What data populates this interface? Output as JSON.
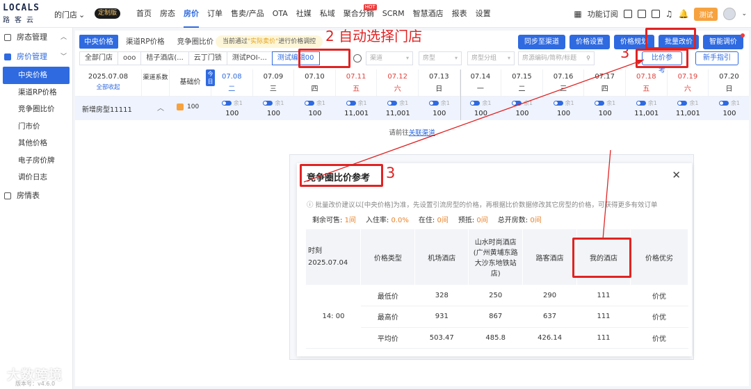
{
  "logo": {
    "main": "LOCALS",
    "sub": "路客云"
  },
  "store": {
    "label": "的门店",
    "badge": "定制版"
  },
  "nav": [
    {
      "label": "首页"
    },
    {
      "label": "房态"
    },
    {
      "label": "房价",
      "active": true
    },
    {
      "label": "订单"
    },
    {
      "label": "售卖/产品"
    },
    {
      "label": "OTA"
    },
    {
      "label": "社媒"
    },
    {
      "label": "私域"
    },
    {
      "label": "聚合分销",
      "hot": "HOT"
    },
    {
      "label": "SCRM"
    },
    {
      "label": "智慧酒店"
    },
    {
      "label": "报表"
    },
    {
      "label": "设置"
    }
  ],
  "topright": {
    "subscription": "功能订阅",
    "test": "测试"
  },
  "sidebar": {
    "group1": "房态管理",
    "group2": "房价管理",
    "items": [
      "中央价格",
      "渠道RP价格",
      "竞争圈比价",
      "门市价",
      "其他价格",
      "电子房价牌",
      "调价日志"
    ],
    "group3": "房情表",
    "version": "版本号：v4.6.0"
  },
  "watermark": "大数跨境",
  "tabs": [
    "中央价格",
    "渠道RP价格",
    "竞争圈比价"
  ],
  "notice": {
    "pre": "当前通过",
    "hl": "\"实际卖价\"",
    "post": "进行价格调控"
  },
  "annotations": {
    "a1": "2 自动选择门店",
    "a2": "3",
    "a3": "3"
  },
  "top_buttons": [
    "同步至渠道",
    "价格设置",
    "价格规划",
    "批量改价",
    "智能调价"
  ],
  "filters": [
    "全部门店",
    "ooo",
    "桔子酒店(...",
    "云丁门锁",
    "测试POI-...",
    "测试编辑00"
  ],
  "selects": {
    "channel": "渠道",
    "room": "房型",
    "group": "房型分组",
    "search": "房源编码/简称/标题"
  },
  "btn_compare": "比价参考",
  "btn_guide": "新手指引",
  "grid": {
    "date_sel": "2025.07.08",
    "collapse": "全部收起",
    "channel_coef": "渠道系数",
    "base_price_label": "基础价",
    "today": "今日",
    "columns": [
      {
        "d": "07.08",
        "w": "二",
        "t": "sel"
      },
      {
        "d": "07.09",
        "w": "三",
        "t": ""
      },
      {
        "d": "07.10",
        "w": "四",
        "t": ""
      },
      {
        "d": "07.11",
        "w": "五",
        "t": "wk"
      },
      {
        "d": "07.12",
        "w": "六",
        "t": "wk"
      },
      {
        "d": "07.13",
        "w": "日",
        "t": ""
      },
      {
        "d": "07.14",
        "w": "一",
        "t": ""
      },
      {
        "d": "07.15",
        "w": "二",
        "t": ""
      },
      {
        "d": "07.16",
        "w": "三",
        "t": ""
      },
      {
        "d": "07.17",
        "w": "四",
        "t": ""
      },
      {
        "d": "07.18",
        "w": "五",
        "t": "wk"
      },
      {
        "d": "07.19",
        "w": "六",
        "t": "wk"
      },
      {
        "d": "07.20",
        "w": "日",
        "t": ""
      }
    ],
    "room": {
      "name": "新增房型11111",
      "base_price": "100",
      "remaining": "余1",
      "prices": [
        "100",
        "100",
        "100",
        "11,001",
        "11,001",
        "100",
        "100",
        "100",
        "100",
        "100",
        "11,001",
        "11,001",
        "100"
      ]
    },
    "link_pre": "请前往",
    "link": "关联渠道"
  },
  "modal": {
    "title": "竞争圈比价参考",
    "note": "批量改价建议以[中央价格]为准，先设置引流房型的价格，再根据比价数据修改其它房型的价格，可获得更多有效订单",
    "stats": [
      {
        "label": "剩余可售:",
        "value": "1间"
      },
      {
        "label": "入住率:",
        "value": "0.0%"
      },
      {
        "label": "在住:",
        "value": "0间"
      },
      {
        "label": "预抵:",
        "value": "0间"
      },
      {
        "label": "总开房数:",
        "value": "0间"
      }
    ],
    "headers": [
      "时刻 2025.07.04",
      "价格类型",
      "机场酒店",
      "山水时尚酒店(广州黄埔东路大沙东地铁站店)",
      "路客酒店",
      "我的酒店",
      "价格优劣"
    ],
    "time": "14: 00",
    "rows": [
      {
        "type": "最低价",
        "v": [
          "328",
          "250",
          "290",
          "111"
        ],
        "adv": "价优"
      },
      {
        "type": "最高价",
        "v": [
          "931",
          "867",
          "637",
          "111"
        ],
        "adv": "价优"
      },
      {
        "type": "平均价",
        "v": [
          "503.47",
          "485.8",
          "426.14",
          "111"
        ],
        "adv": "价优"
      }
    ]
  }
}
